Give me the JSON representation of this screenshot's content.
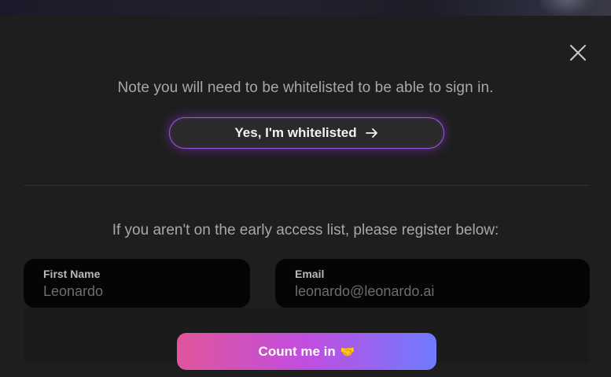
{
  "modal": {
    "whitelist_note": "Note you will need to be whitelisted to be able to sign in.",
    "whitelist_button_label": "Yes, I'm whitelisted",
    "register_note": "If you aren't on the early access list, please register below:"
  },
  "form": {
    "first_name": {
      "label": "First Name",
      "placeholder": "Leonardo",
      "value": ""
    },
    "email": {
      "label": "Email",
      "placeholder": "leonardo@leonardo.ai",
      "value": ""
    },
    "submit_label": "Count me in",
    "submit_emoji": "🤝"
  },
  "colors": {
    "background": "#1e1e1f",
    "accent_border": "#9b59e0",
    "cta_gradient_start": "#e0559b",
    "cta_gradient_end": "#6f7bff"
  },
  "icons": {
    "close": "close-icon",
    "arrow": "arrow-right-icon"
  }
}
